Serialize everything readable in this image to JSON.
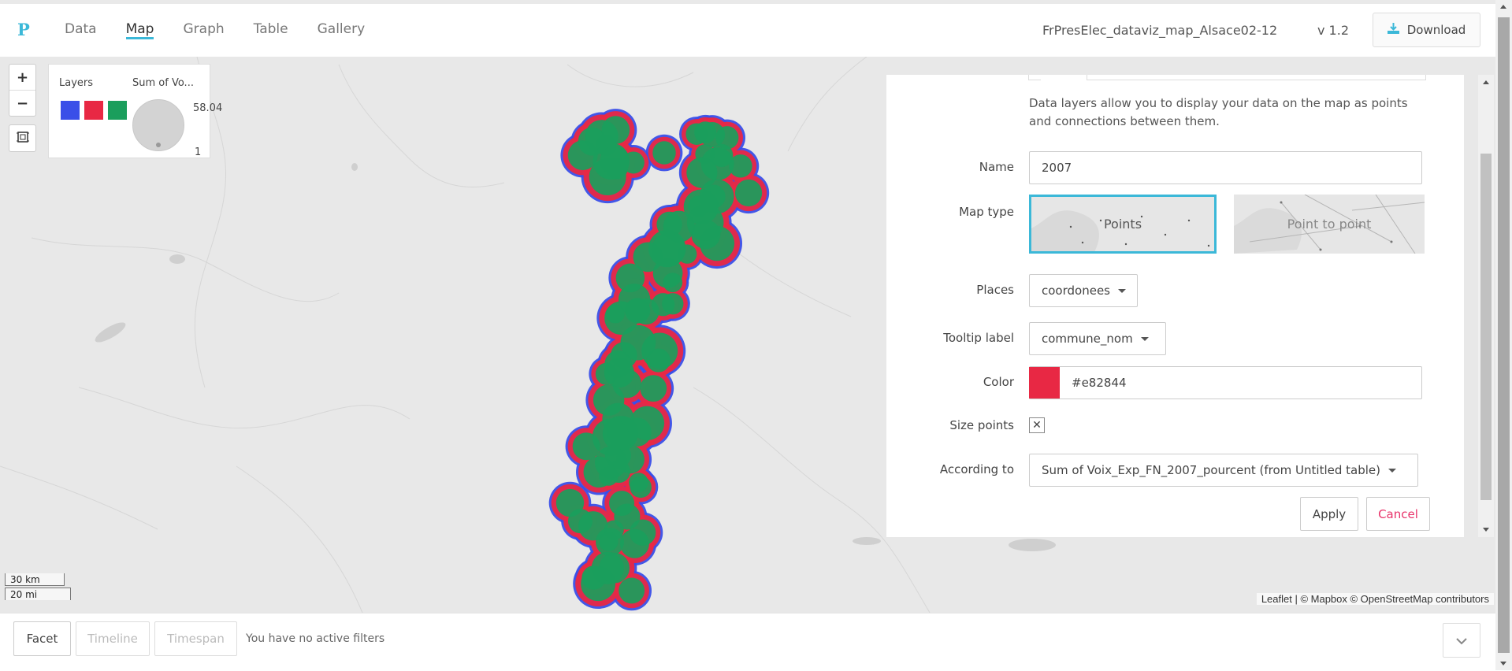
{
  "app": {
    "logo": "P",
    "tabs": [
      {
        "label": "Data",
        "active": false
      },
      {
        "label": "Map",
        "active": true
      },
      {
        "label": "Graph",
        "active": false
      },
      {
        "label": "Table",
        "active": false
      },
      {
        "label": "Gallery",
        "active": false
      }
    ],
    "project_name": "FrPresElec_dataviz_map_Alsace02-12",
    "version": "v 1.2",
    "download_label": "Download",
    "accent_color": "#3bb8d8"
  },
  "map": {
    "zoom_in": "+",
    "zoom_out": "−",
    "legend": {
      "layers_title": "Layers",
      "size_title": "Sum of Vo...",
      "layer_colors": [
        "#3a4fe8",
        "#e82844",
        "#1a9e5c"
      ],
      "size_max": "58.04",
      "size_min": "1"
    },
    "scale": {
      "metric": "30 km",
      "imperial": "20 mi"
    },
    "attribution": "Leaflet | © Mapbox © OpenStreetMap contributors"
  },
  "panel": {
    "description": "Data layers allow you to display your data on the map as points and connections between them.",
    "name_label": "Name",
    "name_value": "2007",
    "map_type_label": "Map type",
    "map_types": [
      {
        "label": "Points",
        "selected": true
      },
      {
        "label": "Point to point",
        "selected": false
      }
    ],
    "places_label": "Places",
    "places_value": "coordonees",
    "tooltip_label": "Tooltip label",
    "tooltip_value": "commune_nom",
    "color_label": "Color",
    "color_value": "#e82844",
    "size_points_label": "Size points",
    "size_points_checked": true,
    "according_label": "According to",
    "according_value": "Sum of Voix_Exp_FN_2007_pourcent (from Untitled table)",
    "apply_label": "Apply",
    "cancel_label": "Cancel",
    "cancel_color": "#e8336a"
  },
  "footer": {
    "facet_label": "Facet",
    "timeline_label": "Timeline",
    "timespan_label": "Timespan",
    "filters_text": "You have no active filters"
  }
}
